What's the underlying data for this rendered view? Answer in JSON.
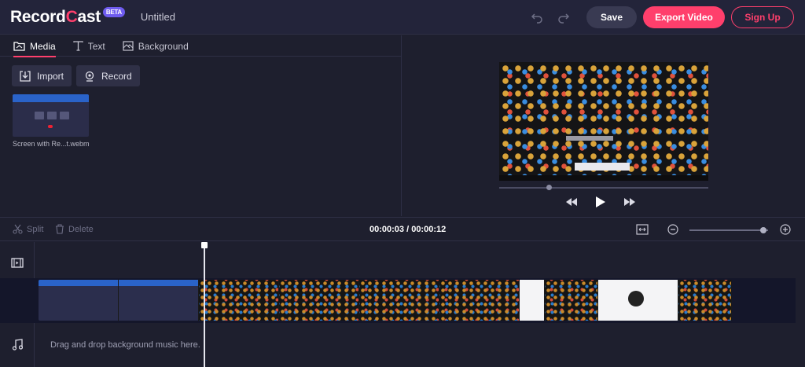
{
  "header": {
    "logo_part1": "Record",
    "logo_part2": "C",
    "logo_part3": "ast",
    "beta": "BETA",
    "title": "Untitled",
    "undo_icon": "undo-icon",
    "redo_icon": "redo-icon",
    "save": "Save",
    "export": "Export Video",
    "signup": "Sign Up"
  },
  "tabs": [
    {
      "label": "Media",
      "icon": "folder-icon",
      "active": true
    },
    {
      "label": "Text",
      "icon": "text-icon",
      "active": false
    },
    {
      "label": "Background",
      "icon": "background-icon",
      "active": false
    }
  ],
  "media": {
    "import": "Import",
    "record": "Record",
    "file_name": "Screen with Re...t.webm"
  },
  "toolbar": {
    "split": "Split",
    "delete": "Delete",
    "timecode": "00:00:03 / 00:00:12"
  },
  "timeline": {
    "music_hint": "Drag and drop background music here."
  },
  "colors": {
    "accent": "#ff3f6c",
    "background": "#1e1f2e",
    "header": "#23243a"
  }
}
